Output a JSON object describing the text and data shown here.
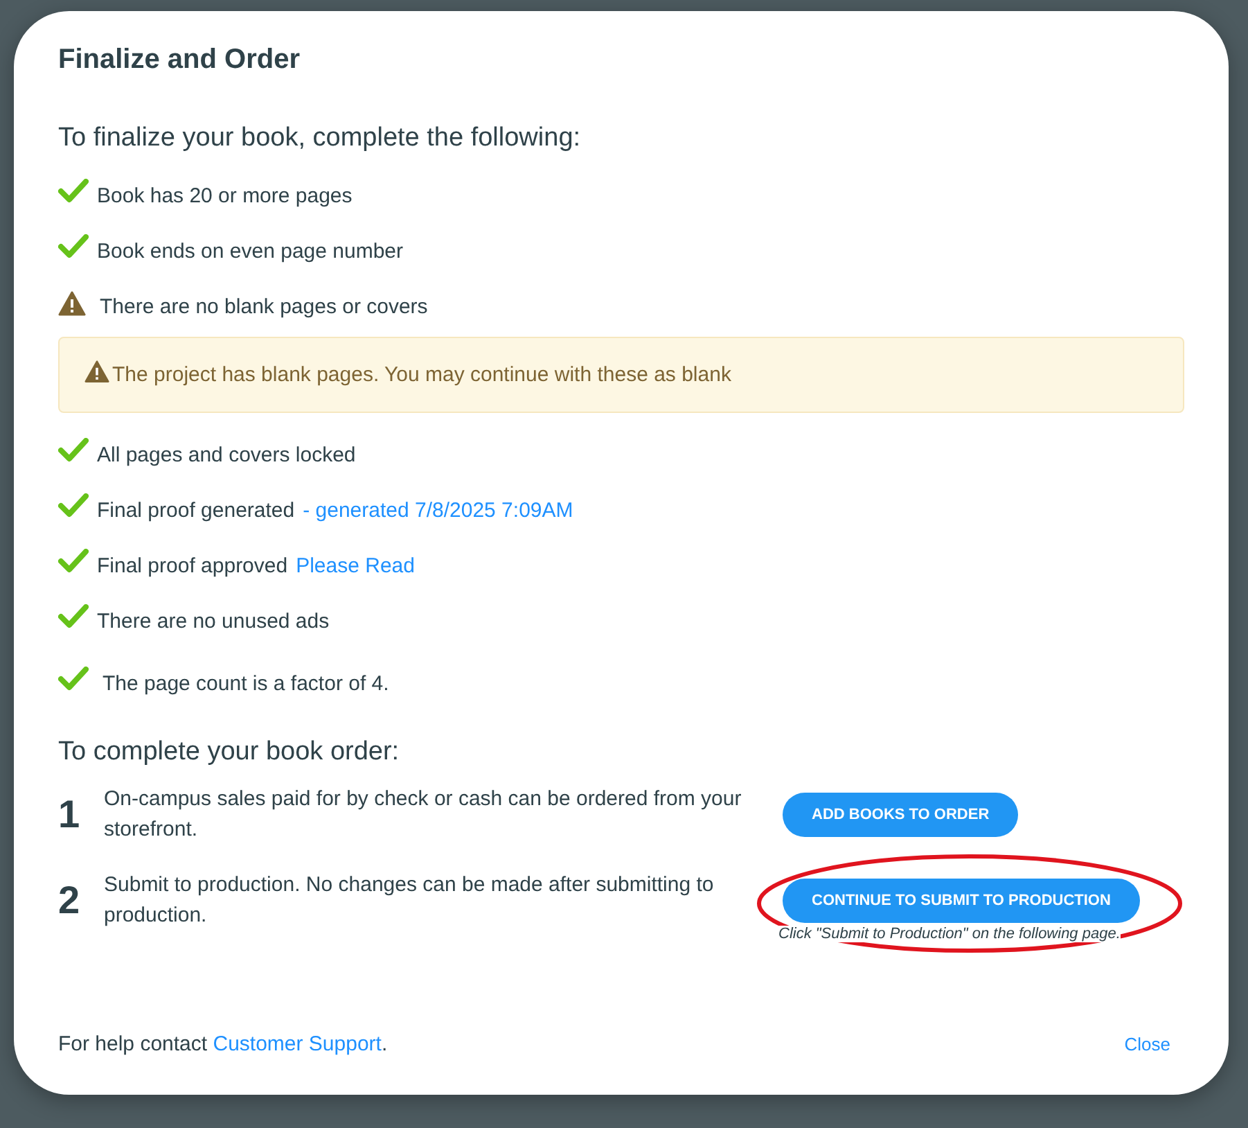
{
  "dialog": {
    "title": "Finalize and Order",
    "checklist_heading": "To finalize your book, complete the following:",
    "checklist": [
      {
        "kind": "check",
        "label": "Book has 20 or more pages"
      },
      {
        "kind": "check",
        "label": "Book ends on even page number"
      },
      {
        "kind": "warning",
        "label": "There are no blank pages or covers",
        "alert": "The project has blank pages. You may continue with these as blank"
      },
      {
        "kind": "check",
        "label": "All pages and covers locked"
      },
      {
        "kind": "check",
        "label": "Final proof generated",
        "link": "- generated 7/8/2025 7:09AM"
      },
      {
        "kind": "check",
        "label": "Final proof approved",
        "link": "Please Read"
      },
      {
        "kind": "check",
        "label": "There are no unused ads"
      },
      {
        "kind": "check",
        "label": "The page count is a factor of 4."
      }
    ],
    "order_heading": "To complete your book order:",
    "steps": [
      {
        "number": "1",
        "text": "On-campus sales paid for by check or cash can be ordered from your storefront.",
        "button": "ADD BOOKS TO ORDER",
        "highlighted": false
      },
      {
        "number": "2",
        "text": "Submit to production. No changes can be made after submitting to production.",
        "button": "CONTINUE TO SUBMIT TO PRODUCTION",
        "note": "Click \"Submit to Production\" on the following page.",
        "highlighted": true
      }
    ],
    "help_text": "For help contact",
    "help_link": "Customer Support",
    "help_end": ".",
    "close": "Close"
  }
}
